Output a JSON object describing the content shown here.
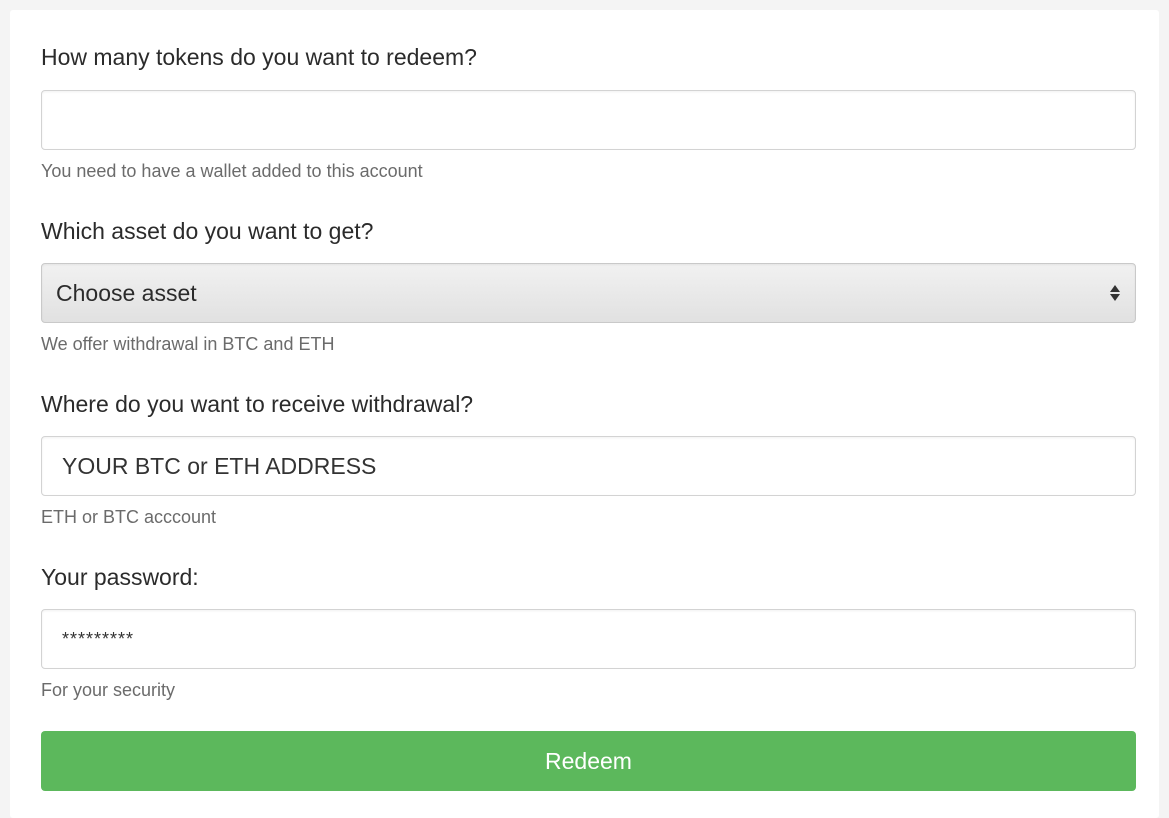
{
  "form": {
    "tokens": {
      "label": "How many tokens do you want to redeem?",
      "value": "",
      "help": "You need to have a wallet added to this account"
    },
    "asset": {
      "label": "Which asset do you want to get?",
      "selected": "Choose asset",
      "help": "We offer withdrawal in BTC and ETH"
    },
    "address": {
      "label": "Where do you want to receive withdrawal?",
      "placeholder": "YOUR BTC or ETH ADDRESS",
      "help": "ETH or BTC acccount"
    },
    "password": {
      "label": "Your password:",
      "value": "*********",
      "help": "For your security"
    },
    "submit_label": "Redeem"
  },
  "colors": {
    "button": "#5cb85c",
    "help_text": "#6b6b6b",
    "border": "#d3d3d3"
  },
  "icons": {
    "select_arrow": "select-arrows-icon"
  }
}
